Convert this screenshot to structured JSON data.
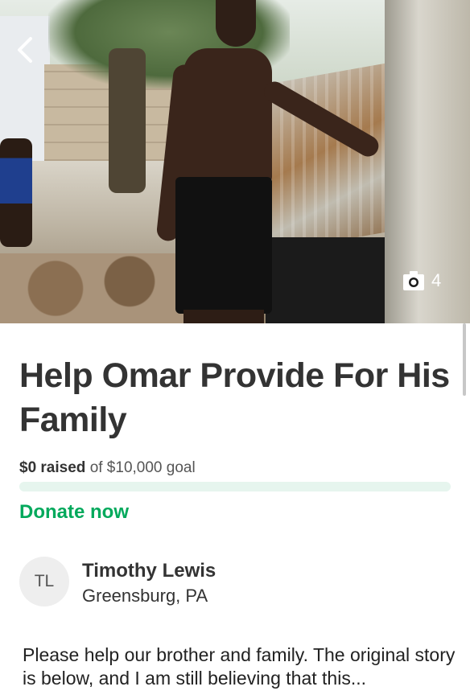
{
  "hero": {
    "photo_count": "4",
    "icons": {
      "back": "chevron-left-icon",
      "camera": "camera-icon"
    }
  },
  "campaign": {
    "title": "Help Omar Provide For His Family",
    "raised_amount": "$0 raised",
    "goal_text": "of $10,000 goal",
    "progress_fraction": 0,
    "donate_label": "Donate now"
  },
  "organizer": {
    "initials": "TL",
    "name": "Timothy Lewis",
    "location": "Greensburg, PA"
  },
  "story": {
    "text": "Please help our brother and family. The original story is below, and I am still believing that this..."
  },
  "colors": {
    "accent_green": "#02a95c",
    "progress_track": "#e6f5ee",
    "title_text": "#333333"
  }
}
